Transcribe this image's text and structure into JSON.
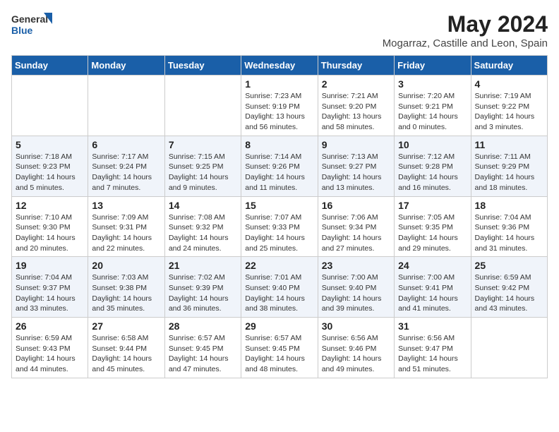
{
  "logo": {
    "general": "General",
    "blue": "Blue"
  },
  "title": "May 2024",
  "subtitle": "Mogarraz, Castille and Leon, Spain",
  "days_of_week": [
    "Sunday",
    "Monday",
    "Tuesday",
    "Wednesday",
    "Thursday",
    "Friday",
    "Saturday"
  ],
  "weeks": [
    [
      {
        "num": "",
        "info": ""
      },
      {
        "num": "",
        "info": ""
      },
      {
        "num": "",
        "info": ""
      },
      {
        "num": "1",
        "info": "Sunrise: 7:23 AM\nSunset: 9:19 PM\nDaylight: 13 hours\nand 56 minutes."
      },
      {
        "num": "2",
        "info": "Sunrise: 7:21 AM\nSunset: 9:20 PM\nDaylight: 13 hours\nand 58 minutes."
      },
      {
        "num": "3",
        "info": "Sunrise: 7:20 AM\nSunset: 9:21 PM\nDaylight: 14 hours\nand 0 minutes."
      },
      {
        "num": "4",
        "info": "Sunrise: 7:19 AM\nSunset: 9:22 PM\nDaylight: 14 hours\nand 3 minutes."
      }
    ],
    [
      {
        "num": "5",
        "info": "Sunrise: 7:18 AM\nSunset: 9:23 PM\nDaylight: 14 hours\nand 5 minutes."
      },
      {
        "num": "6",
        "info": "Sunrise: 7:17 AM\nSunset: 9:24 PM\nDaylight: 14 hours\nand 7 minutes."
      },
      {
        "num": "7",
        "info": "Sunrise: 7:15 AM\nSunset: 9:25 PM\nDaylight: 14 hours\nand 9 minutes."
      },
      {
        "num": "8",
        "info": "Sunrise: 7:14 AM\nSunset: 9:26 PM\nDaylight: 14 hours\nand 11 minutes."
      },
      {
        "num": "9",
        "info": "Sunrise: 7:13 AM\nSunset: 9:27 PM\nDaylight: 14 hours\nand 13 minutes."
      },
      {
        "num": "10",
        "info": "Sunrise: 7:12 AM\nSunset: 9:28 PM\nDaylight: 14 hours\nand 16 minutes."
      },
      {
        "num": "11",
        "info": "Sunrise: 7:11 AM\nSunset: 9:29 PM\nDaylight: 14 hours\nand 18 minutes."
      }
    ],
    [
      {
        "num": "12",
        "info": "Sunrise: 7:10 AM\nSunset: 9:30 PM\nDaylight: 14 hours\nand 20 minutes."
      },
      {
        "num": "13",
        "info": "Sunrise: 7:09 AM\nSunset: 9:31 PM\nDaylight: 14 hours\nand 22 minutes."
      },
      {
        "num": "14",
        "info": "Sunrise: 7:08 AM\nSunset: 9:32 PM\nDaylight: 14 hours\nand 24 minutes."
      },
      {
        "num": "15",
        "info": "Sunrise: 7:07 AM\nSunset: 9:33 PM\nDaylight: 14 hours\nand 25 minutes."
      },
      {
        "num": "16",
        "info": "Sunrise: 7:06 AM\nSunset: 9:34 PM\nDaylight: 14 hours\nand 27 minutes."
      },
      {
        "num": "17",
        "info": "Sunrise: 7:05 AM\nSunset: 9:35 PM\nDaylight: 14 hours\nand 29 minutes."
      },
      {
        "num": "18",
        "info": "Sunrise: 7:04 AM\nSunset: 9:36 PM\nDaylight: 14 hours\nand 31 minutes."
      }
    ],
    [
      {
        "num": "19",
        "info": "Sunrise: 7:04 AM\nSunset: 9:37 PM\nDaylight: 14 hours\nand 33 minutes."
      },
      {
        "num": "20",
        "info": "Sunrise: 7:03 AM\nSunset: 9:38 PM\nDaylight: 14 hours\nand 35 minutes."
      },
      {
        "num": "21",
        "info": "Sunrise: 7:02 AM\nSunset: 9:39 PM\nDaylight: 14 hours\nand 36 minutes."
      },
      {
        "num": "22",
        "info": "Sunrise: 7:01 AM\nSunset: 9:40 PM\nDaylight: 14 hours\nand 38 minutes."
      },
      {
        "num": "23",
        "info": "Sunrise: 7:00 AM\nSunset: 9:40 PM\nDaylight: 14 hours\nand 39 minutes."
      },
      {
        "num": "24",
        "info": "Sunrise: 7:00 AM\nSunset: 9:41 PM\nDaylight: 14 hours\nand 41 minutes."
      },
      {
        "num": "25",
        "info": "Sunrise: 6:59 AM\nSunset: 9:42 PM\nDaylight: 14 hours\nand 43 minutes."
      }
    ],
    [
      {
        "num": "26",
        "info": "Sunrise: 6:59 AM\nSunset: 9:43 PM\nDaylight: 14 hours\nand 44 minutes."
      },
      {
        "num": "27",
        "info": "Sunrise: 6:58 AM\nSunset: 9:44 PM\nDaylight: 14 hours\nand 45 minutes."
      },
      {
        "num": "28",
        "info": "Sunrise: 6:57 AM\nSunset: 9:45 PM\nDaylight: 14 hours\nand 47 minutes."
      },
      {
        "num": "29",
        "info": "Sunrise: 6:57 AM\nSunset: 9:45 PM\nDaylight: 14 hours\nand 48 minutes."
      },
      {
        "num": "30",
        "info": "Sunrise: 6:56 AM\nSunset: 9:46 PM\nDaylight: 14 hours\nand 49 minutes."
      },
      {
        "num": "31",
        "info": "Sunrise: 6:56 AM\nSunset: 9:47 PM\nDaylight: 14 hours\nand 51 minutes."
      },
      {
        "num": "",
        "info": ""
      }
    ]
  ]
}
